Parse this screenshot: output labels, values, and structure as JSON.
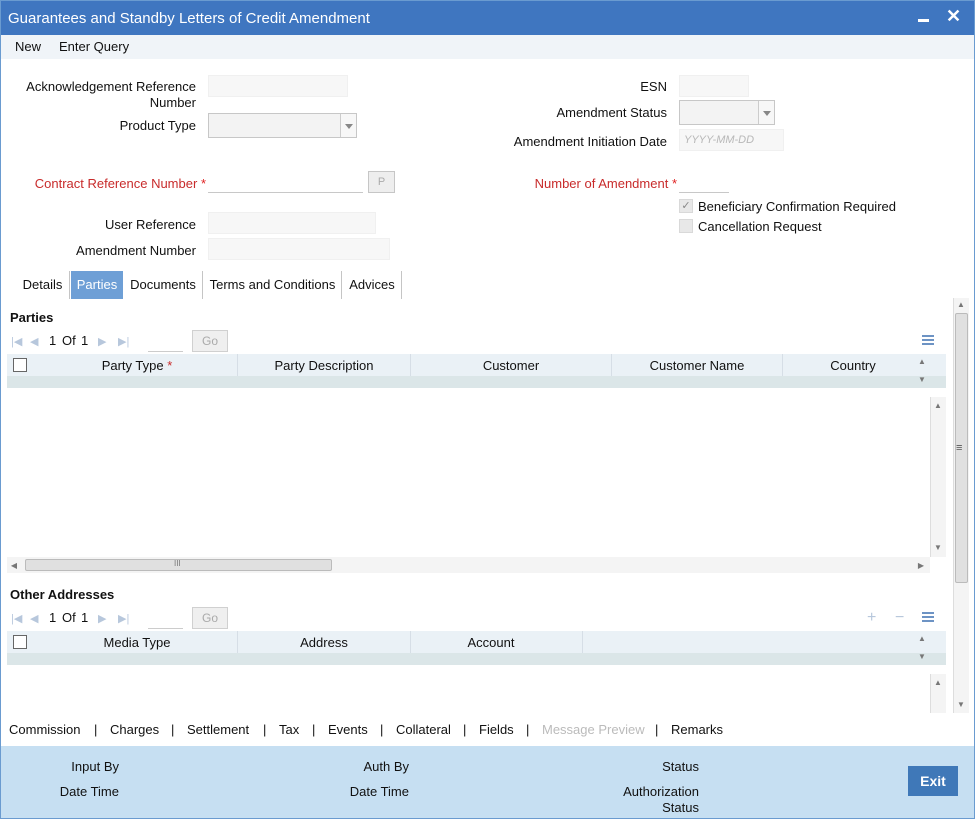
{
  "window": {
    "title": "Guarantees and Standby Letters of Credit Amendment",
    "minimize_label": "",
    "close_label": "✕"
  },
  "menu": {
    "new": "New",
    "enter_query": "Enter Query"
  },
  "form": {
    "ack_ref_label_1": "Acknowledgement Reference",
    "ack_ref_label_2": "Number",
    "ack_ref_value": "",
    "product_type_label": "Product Type",
    "product_type_value": "",
    "contract_ref_label": "Contract Reference Number",
    "contract_ref_value": "",
    "contract_ref_btn": "P",
    "user_ref_label": "User Reference",
    "user_ref_value": "",
    "amendment_number_label": "Amendment Number",
    "amendment_number_value": "",
    "esn_label": "ESN",
    "esn_value": "",
    "amendment_status_label": "Amendment Status",
    "amendment_status_value": "",
    "amendment_init_date_label": "Amendment Initiation Date",
    "amendment_init_date_placeholder": "YYYY-MM-DD",
    "num_amendment_label": "Number of Amendment",
    "num_amendment_value": "",
    "beneficiary_conf_label": "Beneficiary Confirmation Required",
    "beneficiary_conf_checked": true,
    "cancellation_label": "Cancellation Request",
    "cancellation_checked": false,
    "required_mark": "*"
  },
  "tabs": [
    "Details",
    "Parties",
    "Documents",
    "Terms and Conditions",
    "Advices"
  ],
  "active_tab": "Parties",
  "parties": {
    "title": "Parties",
    "page": "1",
    "of": "Of",
    "total": "1",
    "go": "Go",
    "columns": [
      "Party Type",
      "Party Description",
      "Customer",
      "Customer Name",
      "Country"
    ],
    "party_type_required": "*",
    "hscroll_mark": "III",
    "vscroll_mark": "≡"
  },
  "other_addresses": {
    "title": "Other Addresses",
    "page": "1",
    "of": "Of",
    "total": "1",
    "go": "Go",
    "columns": [
      "Media Type",
      "Address",
      "Account"
    ],
    "add": "+",
    "remove": "−"
  },
  "bottom_links": [
    "Commission",
    "Charges",
    "Settlement",
    "Tax",
    "Events",
    "Collateral",
    "Fields",
    "Message Preview",
    "Remarks"
  ],
  "bottom_sep": "|",
  "footer": {
    "input_by": "Input By",
    "date_time_1": "Date Time",
    "auth_by": "Auth By",
    "date_time_2": "Date Time",
    "status": "Status",
    "auth_status_1": "Authorization",
    "auth_status_2": "Status",
    "exit": "Exit"
  },
  "colors": {
    "titlebar": "#3f76c0",
    "active_tab": "#6e9fd6",
    "footer": "#c6dff2",
    "exit": "#3f78b8",
    "required": "#c82b2b"
  }
}
